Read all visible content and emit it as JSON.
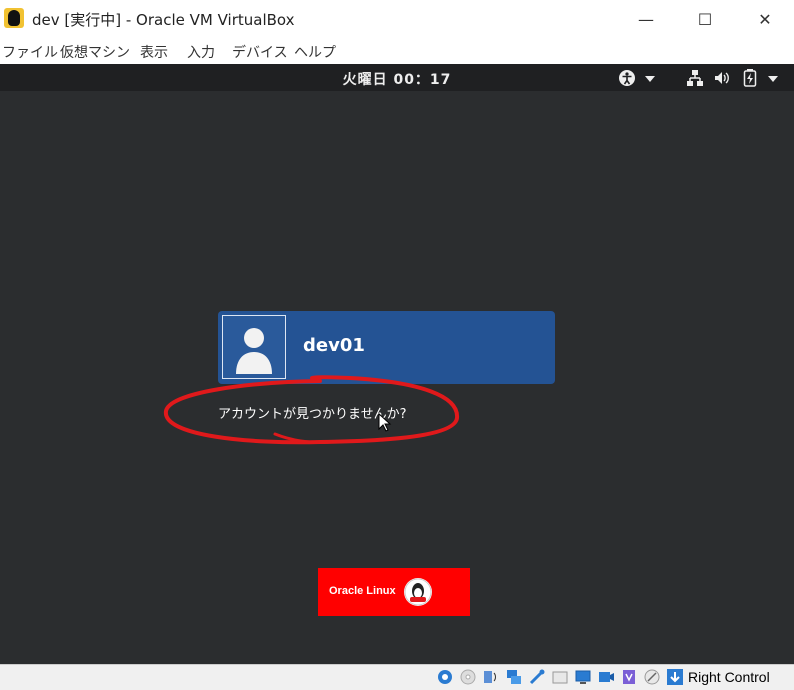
{
  "window": {
    "title": "dev [実行中] - Oracle VM VirtualBox",
    "minimize_glyph": "—",
    "maximize_glyph": "☐",
    "close_glyph": "✕"
  },
  "menu": {
    "items": [
      {
        "label": "ファイル"
      },
      {
        "label": "仮想マシン"
      },
      {
        "label": "表示"
      },
      {
        "label": "入力"
      },
      {
        "label": "デバイス"
      },
      {
        "label": "ヘルプ"
      }
    ]
  },
  "guest": {
    "clock": "火曜日 00：17",
    "tray": {
      "accessibility_icon": "accessibility-icon",
      "network_icon": "network-icon",
      "volume_icon": "volume-icon",
      "battery_icon": "battery-icon"
    },
    "user": {
      "name": "dev01"
    },
    "not_listed_label": "アカウントが見つかりませんか?",
    "oracle_logo_text": "Oracle Linux",
    "colors": {
      "background": "#2b2d2f",
      "user_card": "#245394",
      "annotation": "#e0191b",
      "oracle_red": "#ff0000"
    }
  },
  "statusbar": {
    "host_key": "Right Control"
  }
}
